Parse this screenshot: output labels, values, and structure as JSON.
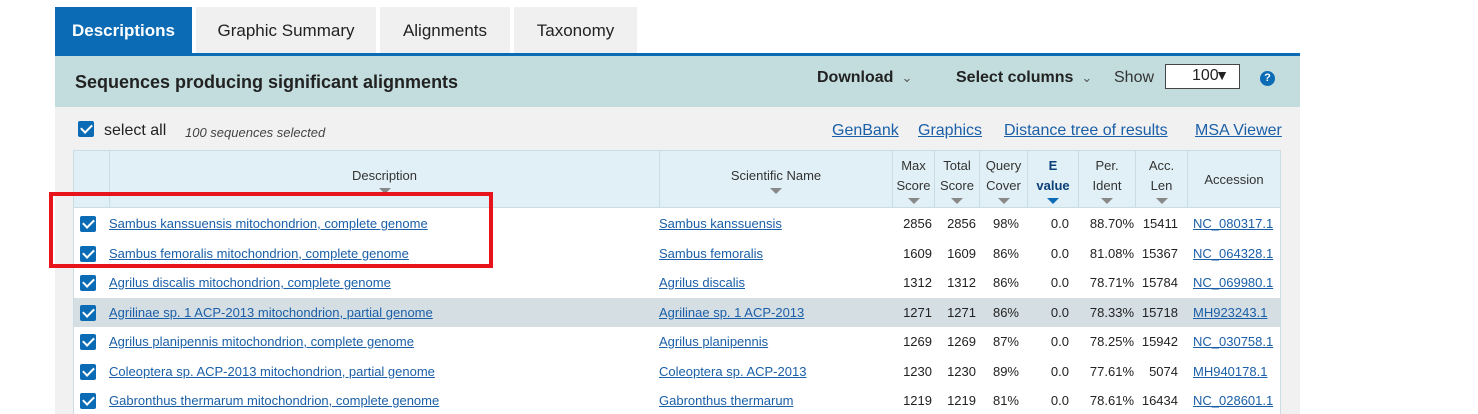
{
  "tabs": [
    {
      "label": "Descriptions",
      "active": true
    },
    {
      "label": "Graphic Summary",
      "active": false
    },
    {
      "label": "Alignments",
      "active": false
    },
    {
      "label": "Taxonomy",
      "active": false
    }
  ],
  "header": {
    "title": "Sequences producing significant alignments",
    "download": "Download",
    "select_columns": "Select columns",
    "show_label": "Show",
    "show_value": "100",
    "help_icon": "?"
  },
  "toolbar": {
    "select_all": "select all",
    "selected_count": "100 sequences selected",
    "links": [
      "GenBank",
      "Graphics",
      "Distance tree of results",
      "MSA Viewer"
    ]
  },
  "columns": {
    "description": "Description",
    "scientific_name": "Scientific Name",
    "max_score": [
      "Max",
      "Score"
    ],
    "total_score": [
      "Total",
      "Score"
    ],
    "query_cover": [
      "Query",
      "Cover"
    ],
    "e_value": [
      "E",
      "value"
    ],
    "per_ident": [
      "Per.",
      "Ident"
    ],
    "acc_len": [
      "Acc.",
      "Len"
    ],
    "accession": "Accession"
  },
  "rows": [
    {
      "description": "Sambus kanssuensis mitochondrion, complete genome",
      "scientific_name": "Sambus kanssuensis",
      "max_score": "2856",
      "total_score": "2856",
      "query_cover": "98%",
      "e_value": "0.0",
      "per_ident": "88.70%",
      "acc_len": "15411",
      "accession": "NC_080317.1",
      "checked": true,
      "highlighted": false
    },
    {
      "description": "Sambus femoralis mitochondrion, complete genome",
      "scientific_name": "Sambus femoralis",
      "max_score": "1609",
      "total_score": "1609",
      "query_cover": "86%",
      "e_value": "0.0",
      "per_ident": "81.08%",
      "acc_len": "15367",
      "accession": "NC_064328.1",
      "checked": true,
      "highlighted": false
    },
    {
      "description": "Agrilus discalis mitochondrion, complete genome",
      "scientific_name": "Agrilus discalis",
      "max_score": "1312",
      "total_score": "1312",
      "query_cover": "86%",
      "e_value": "0.0",
      "per_ident": "78.71%",
      "acc_len": "15784",
      "accession": "NC_069980.1",
      "checked": true,
      "highlighted": false
    },
    {
      "description": "Agrilinae sp. 1 ACP-2013 mitochondrion, partial genome",
      "scientific_name": "Agrilinae sp. 1 ACP-2013",
      "max_score": "1271",
      "total_score": "1271",
      "query_cover": "86%",
      "e_value": "0.0",
      "per_ident": "78.33%",
      "acc_len": "15718",
      "accession": "MH923243.1",
      "checked": true,
      "highlighted": true
    },
    {
      "description": "Agrilus planipennis mitochondrion, complete genome",
      "scientific_name": "Agrilus planipennis",
      "max_score": "1269",
      "total_score": "1269",
      "query_cover": "87%",
      "e_value": "0.0",
      "per_ident": "78.25%",
      "acc_len": "15942",
      "accession": "NC_030758.1",
      "checked": true,
      "highlighted": false
    },
    {
      "description": "Coleoptera sp. ACP-2013 mitochondrion, partial genome",
      "scientific_name": "Coleoptera sp. ACP-2013",
      "max_score": "1230",
      "total_score": "1230",
      "query_cover": "89%",
      "e_value": "0.0",
      "per_ident": "77.61%",
      "acc_len": "5074",
      "accession": "MH940178.1",
      "checked": true,
      "highlighted": false
    },
    {
      "description": "Gabronthus thermarum mitochondrion, complete genome",
      "scientific_name": "Gabronthus thermarum",
      "max_score": "1219",
      "total_score": "1219",
      "query_cover": "81%",
      "e_value": "0.0",
      "per_ident": "78.61%",
      "acc_len": "16434",
      "accession": "NC_028601.1",
      "checked": true,
      "highlighted": false
    }
  ],
  "colors": {
    "accent": "#0b6bb5",
    "header_band": "#c3ddde",
    "annotation_box": "#e8141c",
    "row_highlight": "#d5dee3"
  }
}
